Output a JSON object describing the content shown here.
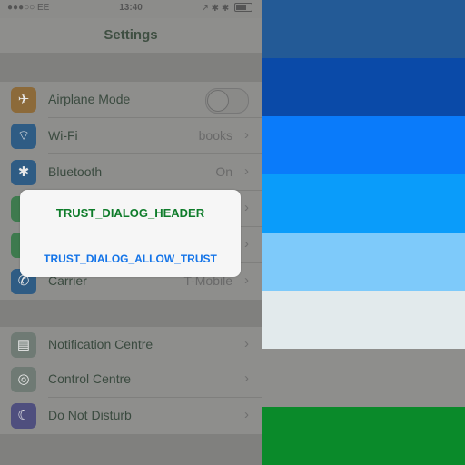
{
  "status_bar": {
    "carrier": "●●●○○ EE",
    "time": "13:40",
    "indicators": "↗ ✱ ✱"
  },
  "nav": {
    "title": "Settings"
  },
  "rows_group1": [
    {
      "label": "Airplane Mode",
      "value": "",
      "icon": "airplane-icon",
      "glyph": "✈"
    },
    {
      "label": "Wi-Fi",
      "value": "books",
      "icon": "wifi-icon",
      "glyph": "⌔"
    },
    {
      "label": "Bluetooth",
      "value": "On",
      "icon": "bluetooth-icon",
      "glyph": "✱"
    },
    {
      "label": "",
      "value": "",
      "icon": "cellular-icon",
      "glyph": ""
    },
    {
      "label": "",
      "value": "",
      "icon": "hotspot-icon",
      "glyph": ""
    },
    {
      "label": "Carrier",
      "value": "T-Mobile",
      "icon": "phone-icon",
      "glyph": "✆"
    }
  ],
  "rows_group2": [
    {
      "label": "Notification Centre",
      "value": "",
      "icon": "notification-centre-icon",
      "glyph": "▤"
    },
    {
      "label": "Control Centre",
      "value": "",
      "icon": "control-centre-icon",
      "glyph": "◎"
    },
    {
      "label": "Do Not Disturb",
      "value": "",
      "icon": "moon-icon",
      "glyph": "☾"
    }
  ],
  "dialog": {
    "header": "TRUST_DIALOG_HEADER",
    "allow": "TRUST_DIALOG_ALLOW_TRUST"
  },
  "colors": {
    "stripes": [
      "#235a96",
      "#0a4aa8",
      "#0a7bfa",
      "#0a9cfa",
      "#7ecafa",
      "#e2eaec",
      "#8e8e8c",
      "#0a8a2a"
    ],
    "dialog_header": "#0e7c2a",
    "dialog_link": "#1474e8"
  }
}
